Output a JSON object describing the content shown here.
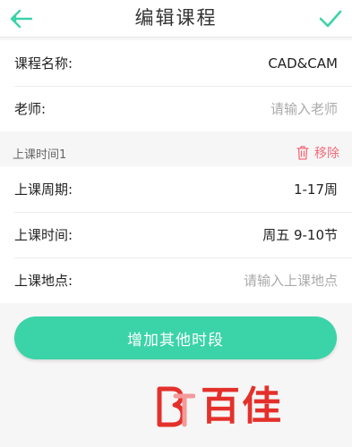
{
  "header": {
    "title": "编辑课程",
    "back_icon": "back-arrow-icon",
    "confirm_icon": "check-icon",
    "accent_color": "#3bd3a8"
  },
  "course": {
    "name_label": "课程名称:",
    "name_value": "CAD&CAM",
    "teacher_label": "老师:",
    "teacher_placeholder": "请输入老师"
  },
  "time_slot": {
    "section_title": "上课时间1",
    "remove_label": "移除",
    "remove_icon": "trash-icon",
    "remove_color": "#f26b7a",
    "weeks_label": "上课周期:",
    "weeks_value": "1-17周",
    "time_label": "上课时间:",
    "time_value": "周五 9-10节",
    "location_label": "上课地点:",
    "location_placeholder": "请输入上课地点"
  },
  "actions": {
    "add_time_label": "增加其他时段"
  },
  "watermark": {
    "text": "百佳"
  }
}
